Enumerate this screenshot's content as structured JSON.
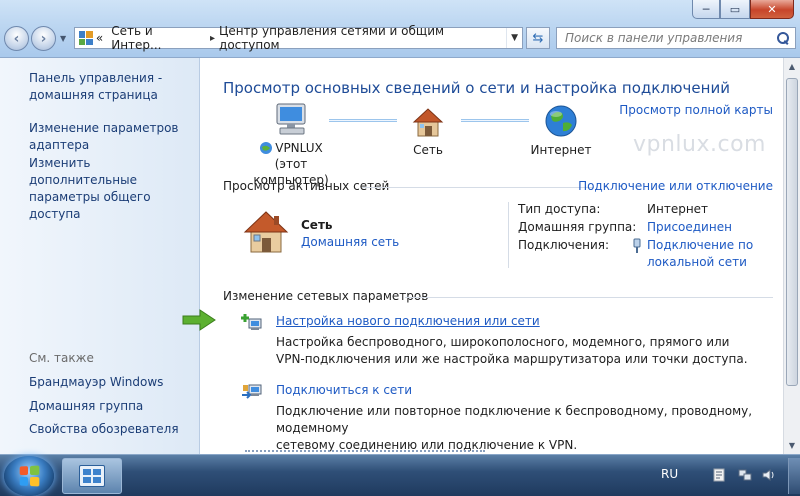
{
  "window": {
    "minimize_glyph": "─",
    "maximize_glyph": "▭",
    "close_glyph": "✕"
  },
  "addressbar": {
    "crumb_prefix": "«",
    "crumb_1": "Сеть и Интер...",
    "crumb_sep": "▸",
    "crumb_2": "Центр управления сетями и общим доступом"
  },
  "search": {
    "placeholder": "Поиск в панели управления"
  },
  "sidebar": {
    "items": [
      {
        "label": "Панель управления - домашняя страница"
      },
      {
        "label": "Изменение параметров адаптера"
      },
      {
        "label": "Изменить дополнительные параметры общего доступа"
      }
    ],
    "see_also_title": "См. также",
    "see_also": [
      {
        "label": "Брандмауэр Windows"
      },
      {
        "label": "Домашняя группа"
      },
      {
        "label": "Свойства обозревателя"
      }
    ]
  },
  "main": {
    "heading": "Просмотр основных сведений о сети и настройка подключений",
    "full_map_link": "Просмотр полной карты",
    "watermark": "vpnlux.com",
    "map": {
      "computer_name": "VPNLUX",
      "computer_caption": "(этот компьютер)",
      "network": "Сеть",
      "internet": "Интернет"
    },
    "active_title": "Просмотр активных сетей",
    "connect_link": "Подключение или отключение",
    "active_network": {
      "name": "Сеть",
      "type": "Домашняя сеть",
      "access_type_label": "Тип доступа:",
      "access_type_value": "Интернет",
      "homegroup_label": "Домашняя группа:",
      "homegroup_value": "Присоединен",
      "connections_label": "Подключения:",
      "connections_value_1": "Подключение по",
      "connections_value_2": "локальной сети"
    },
    "change_title": "Изменение сетевых параметров",
    "tasks": [
      {
        "title": "Настройка нового подключения или сети",
        "desc_1": "Настройка беспроводного, широкополосного, модемного, прямого или",
        "desc_2": "VPN-подключения или же настройка маршрутизатора или точки доступа."
      },
      {
        "title": "Подключиться к сети",
        "desc_1": "Подключение или повторное подключение к беспроводному, проводному, модемному",
        "desc_2": "сетевому соединению или подключение к VPN."
      }
    ]
  },
  "taskbar": {
    "lang": "RU"
  },
  "colors": {
    "link": "#1e5ac4",
    "heading": "#1e4b97",
    "sidebar_link": "#1b3d76",
    "arrow_green": "#5cb030"
  },
  "icons": [
    "back-arrow-icon",
    "forward-arrow-icon",
    "refresh-icon",
    "search-icon",
    "help-icon",
    "computer-icon",
    "house-icon",
    "globe-icon",
    "network-plug-icon",
    "new-connection-icon",
    "connect-network-icon",
    "green-arrow-icon",
    "windows-logo-icon"
  ]
}
